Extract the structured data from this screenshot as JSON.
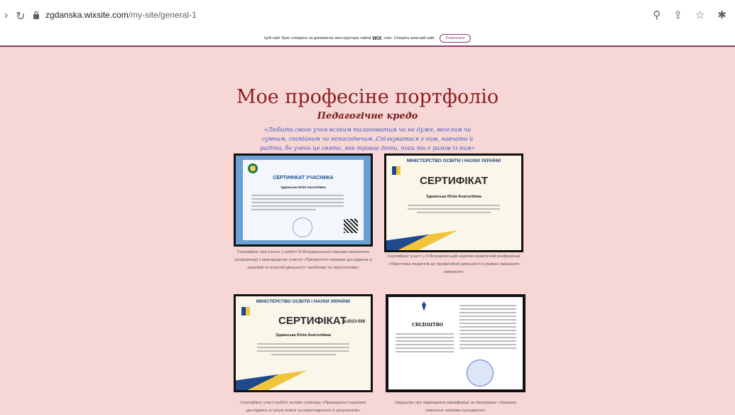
{
  "browser": {
    "url_domain": "zgdanska.wixsite.com",
    "url_path": "/my-site/general-1"
  },
  "wix_banner": {
    "text": "Цей сайт було створено за допомогою конструктора сайтів",
    "brand": "WiX",
    "text_after": ".com. Створіть власний сайт.",
    "button": "Розпочати"
  },
  "page": {
    "title": "Мое професіне портфоліо",
    "subtitle": "Педагогічне кредо",
    "motto": "«Любити свого учня всяким талановитим чи не дуже, веселим чи сумним, спокійним чи непосидючим..Спілкуватися з ним, навчати й радіти, бо учень це свято, яке триває доти, поки ти є разом із ним»"
  },
  "certificates": [
    {
      "header": "СЕРТИФІКАТ УЧАСНИКА",
      "name": "Здканська Юлія Анатоліївна",
      "caption": "Сертифікат про участь у роботі III Всеукраїнської науково-практичної конференції з міжнародною участю «Пріоритетні напрями досліджень в науковій та освітній діяльності: проблеми та перспективи»"
    },
    {
      "ministry": "МІНІСТЕРСТВО ОСВІТИ І НАУКИ УКРАЇНИ",
      "header": "СЕРТИФІКАТ",
      "name": "Здканська Юлія Анатоліївна",
      "caption": "Сертифікат участі у II Всеукраїнській науково-практичній конференції «Підготовка педагогів до професійної діяльності в умовах змішаного навчання»"
    },
    {
      "ministry": "МІНІСТЕРСТВО ОСВІТИ І НАУКИ УКРАЇНИ",
      "header": "СЕРТИФІКАТ",
      "number": "№2023-098",
      "name": "Здканська Юлія Анатоліївна",
      "caption": "Сертифікат участі роботі онлайн семінару «Проведення наукових досліджень в галузі освіти та оприлюднення їх результатів»"
    },
    {
      "header": "СВІДОЦТВО",
      "caption": "Свідоцтво про підвищення кваліфікації за програмою «Змішане навчання: виклики сьогодення»"
    }
  ]
}
